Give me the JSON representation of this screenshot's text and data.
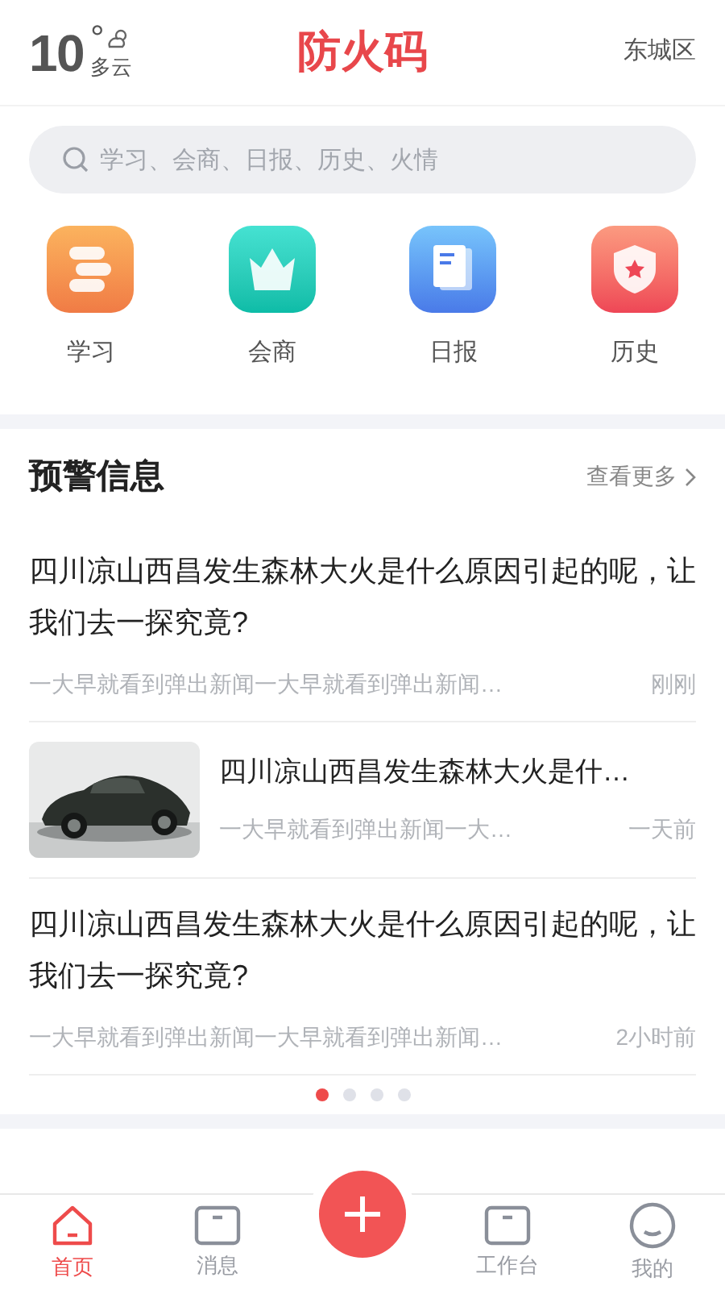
{
  "header": {
    "temperature": "10",
    "degree": "°",
    "weather": "多云",
    "title": "防火码",
    "location": "东城区"
  },
  "search": {
    "placeholder": "学习、会商、日报、历史、火情"
  },
  "shortcuts": [
    {
      "label": "学习",
      "kind": "books"
    },
    {
      "label": "会商",
      "kind": "crown"
    },
    {
      "label": "日报",
      "kind": "report"
    },
    {
      "label": "历史",
      "kind": "shield"
    }
  ],
  "warning": {
    "title": "预警信息",
    "more": "查看更多",
    "items": [
      {
        "kind": "text",
        "title": "四川凉山西昌发生森林大火是什么原因引起的呢，让我们去一探究竟?",
        "summary": "一大早就看到弹出新闻一大早就看到弹出新闻…",
        "time": "刚刚"
      },
      {
        "title": "四川凉山西昌发生森林大火是什…",
        "summary": "一大早就看到弹出新闻一大…",
        "time": "一天前"
      },
      {
        "kind": "text",
        "title": "四川凉山西昌发生森林大火是什么原因引起的呢，让我们去一探究竟?",
        "summary": "一大早就看到弹出新闻一大早就看到弹出新闻…",
        "time": "2小时前"
      }
    ],
    "pages": [
      {
        "selected": true
      },
      {
        "selected": false
      },
      {
        "selected": false
      },
      {
        "selected": false
      }
    ]
  },
  "tabs": [
    {
      "label": "首页",
      "kind": "home",
      "selected": true
    },
    {
      "label": "消息",
      "kind": "inbox",
      "selected": false
    },
    {
      "kind": "add"
    },
    {
      "label": "工作台",
      "kind": "inbox",
      "selected": false
    },
    {
      "label": "我的",
      "kind": "face",
      "selected": false
    }
  ]
}
